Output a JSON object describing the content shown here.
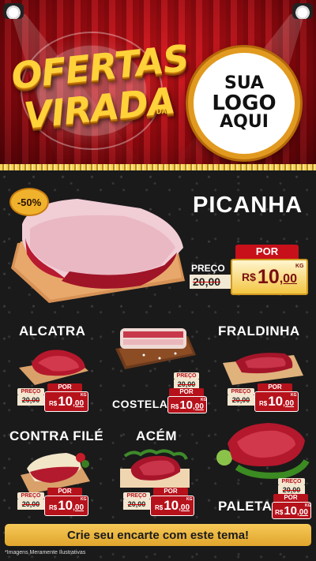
{
  "header": {
    "title_line1": "OFERTAS",
    "title_line2": "VIRADA",
    "title_small": "DA",
    "logo_line1": "SUA",
    "logo_line2": "LOGO",
    "logo_line3": "AQUI"
  },
  "hero": {
    "discount": "-50%",
    "name": "PICANHA",
    "old_label": "PREÇO",
    "old_price": "20,00",
    "por_label": "POR",
    "currency": "R$",
    "price_int": "10",
    "price_cents": ",00",
    "unit": "KG"
  },
  "products": [
    {
      "name": "ALCATRA",
      "old_label": "PREÇO",
      "old_price": "20,00",
      "por_label": "POR",
      "currency": "R$",
      "price_int": "10",
      "price_cents": ",00",
      "unit": "KG"
    },
    {
      "name": "COSTELA",
      "old_label": "PREÇO",
      "old_price": "20,00",
      "por_label": "POR",
      "currency": "R$",
      "price_int": "10",
      "price_cents": ",00",
      "unit": "KG"
    },
    {
      "name": "FRALDINHA",
      "old_label": "PREÇO",
      "old_price": "20,00",
      "por_label": "POR",
      "currency": "R$",
      "price_int": "10",
      "price_cents": ",00",
      "unit": "KG"
    },
    {
      "name": "CONTRA FILÉ",
      "old_label": "PREÇO",
      "old_price": "20,00",
      "por_label": "POR",
      "currency": "R$",
      "price_int": "10",
      "price_cents": ",00",
      "unit": "KG"
    },
    {
      "name": "ACÉM",
      "old_label": "PREÇO",
      "old_price": "20,00",
      "por_label": "POR",
      "currency": "R$",
      "price_int": "10",
      "price_cents": ",00",
      "unit": "KG"
    },
    {
      "name": "PALETA",
      "old_label": "PREÇO",
      "old_price": "20,00",
      "por_label": "POR",
      "currency": "R$",
      "price_int": "10",
      "price_cents": ",00",
      "unit": "KG"
    }
  ],
  "footer": {
    "cta": "Crie seu encarte com este tema!",
    "disclaimer": "*Imagens Meramente Ilustrativas"
  },
  "colors": {
    "brand_red": "#b6121b",
    "gold": "#f0b22d",
    "background": "#1a1a1a"
  }
}
